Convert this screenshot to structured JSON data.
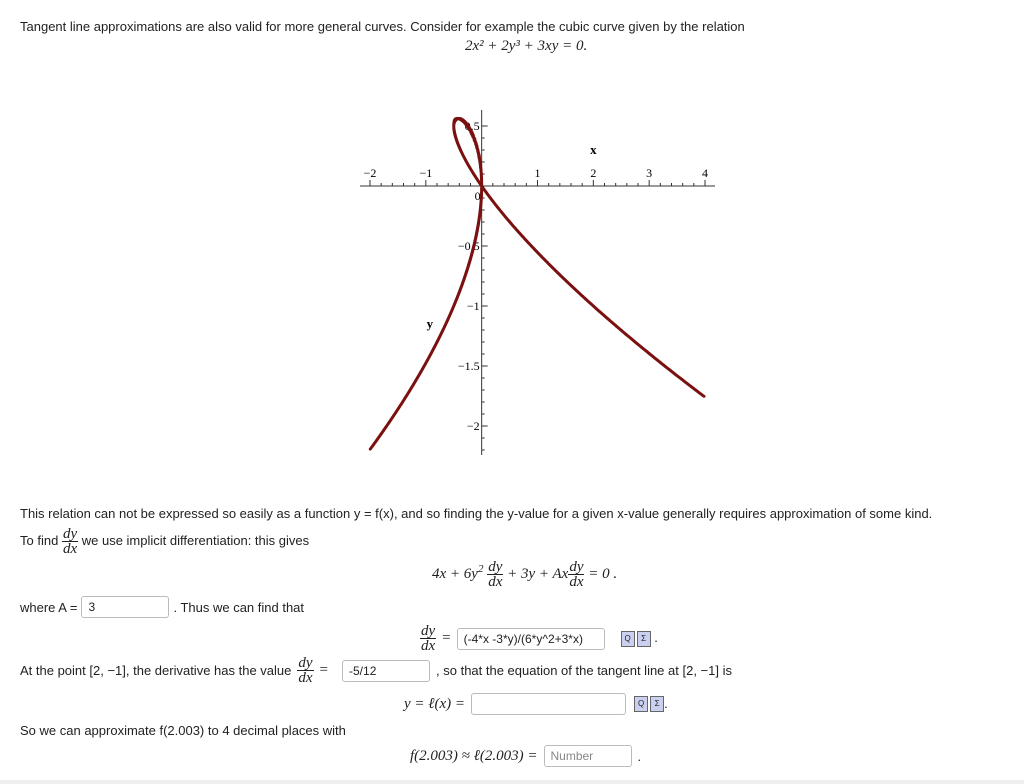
{
  "intro": "Tangent line approximations are also valid for more general curves. Consider for example the cubic curve given by the relation",
  "equation": "2x² + 2y³ + 3xy = 0.",
  "chart_data": {
    "type": "line",
    "relation": "2x^2 + 2y^3 + 3xy = 0",
    "xlabel": "x",
    "ylabel": "y",
    "xlim": [
      -2,
      4
    ],
    "ylim": [
      -2.2,
      0.6
    ],
    "x_ticks": [
      "−2",
      "−1",
      "0",
      "1",
      "2",
      "3",
      "4"
    ],
    "y_ticks": [
      "0.5",
      "−0.5",
      "−1",
      "−1.5",
      "−2"
    ],
    "color": "#7a1010"
  },
  "para1": "This relation can not be expressed so easily as a function y = f(x), and so finding the y-value for a given x-value generally requires approximation of some kind.",
  "to_find": "To find",
  "to_find2": "we use implicit differentiation: this gives",
  "dy": "dy",
  "dx": "dx",
  "implicit_eq": {
    "a": "4x + 6y",
    "b": "2",
    "c": " + 3y + Ax",
    "d": " = 0 ."
  },
  "where_a": "where A =",
  "a_value": "3",
  "thus": ". Thus we can find that",
  "dydx_value": "(-4*x -3*y)/(6*y^2+3*x)",
  "at_point": "At the point [2, −1], the derivative has the value",
  "eq": "=",
  "deriv_value": "-5/12",
  "so_that": ", so that the equation of the tangent line at [2, −1] is",
  "tangent_label": "y = ℓ(x) =",
  "tangent_value": "",
  "approx_text": "So we can approximate f(2.003) to 4 decimal places with",
  "approx_label": "f(2.003) ≈ ℓ(2.003) =",
  "approx_placeholder": "Number",
  "period": "."
}
